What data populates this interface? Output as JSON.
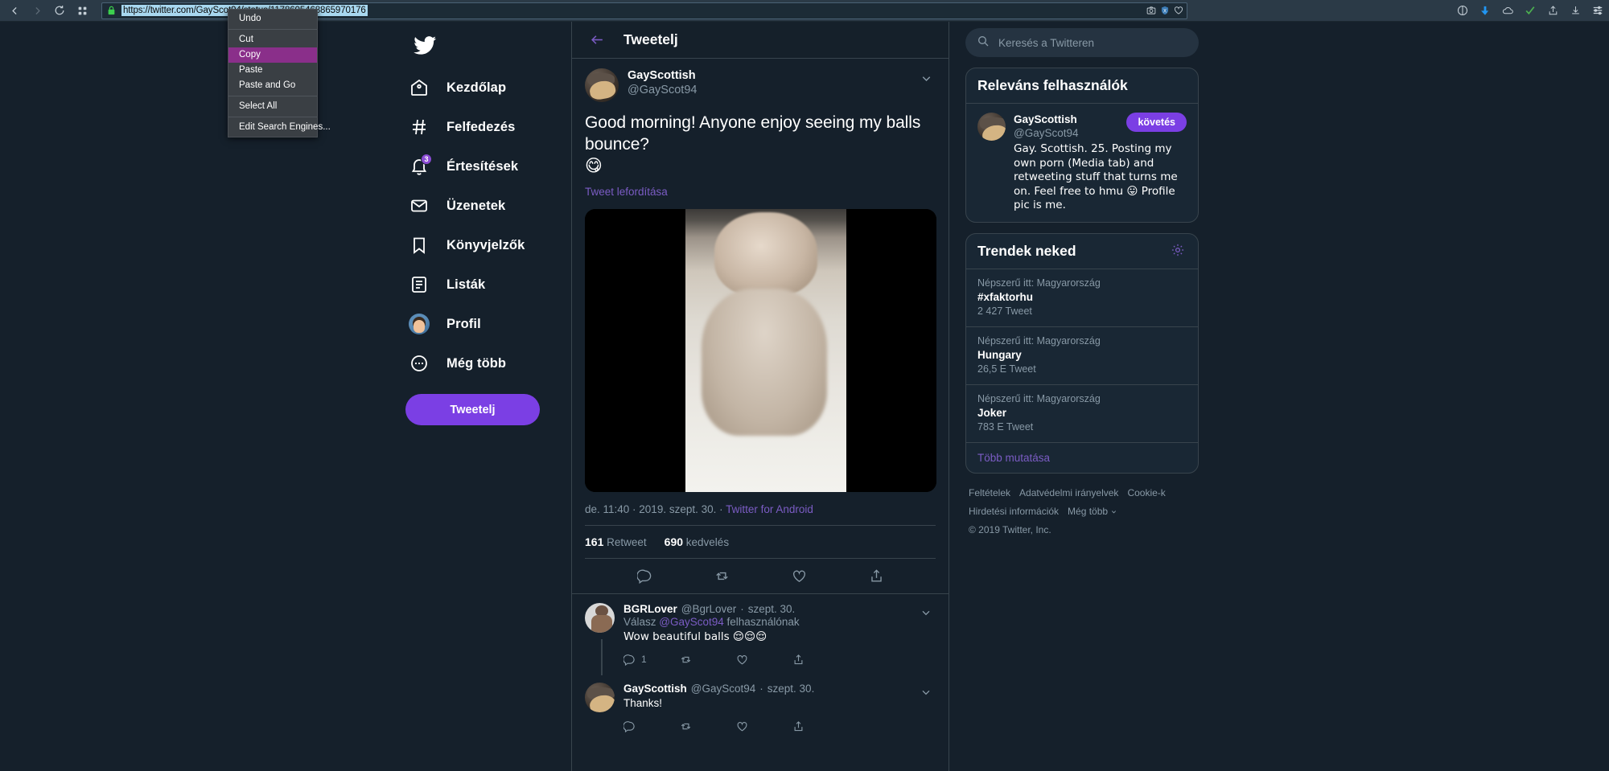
{
  "browser": {
    "url": "https://twitter.com/GayScot94/status/1178605468865970176",
    "nav": {
      "back": "‹",
      "forward": "›"
    },
    "context_menu": {
      "items": [
        {
          "label": "Undo",
          "selected": false,
          "sep_after": true
        },
        {
          "label": "Cut",
          "selected": false,
          "sep_after": false
        },
        {
          "label": "Copy",
          "selected": true,
          "sep_after": false
        },
        {
          "label": "Paste",
          "selected": false,
          "sep_after": false
        },
        {
          "label": "Paste and Go",
          "selected": false,
          "sep_after": true
        },
        {
          "label": "Select All",
          "selected": false,
          "sep_after": true
        },
        {
          "label": "Edit Search Engines...",
          "selected": false,
          "sep_after": false
        }
      ]
    }
  },
  "sidebar": {
    "logo": "twitter-bird",
    "items": [
      {
        "label": "Kezdőlap",
        "icon": "home-icon",
        "badge": ""
      },
      {
        "label": "Felfedezés",
        "icon": "hashtag-icon",
        "badge": ""
      },
      {
        "label": "Értesítések",
        "icon": "bell-icon",
        "badge": "3"
      },
      {
        "label": "Üzenetek",
        "icon": "envelope-icon",
        "badge": ""
      },
      {
        "label": "Könyvjelzők",
        "icon": "bookmark-icon",
        "badge": ""
      },
      {
        "label": "Listák",
        "icon": "list-icon",
        "badge": ""
      },
      {
        "label": "Profil",
        "icon": "avatar-icon",
        "badge": ""
      },
      {
        "label": "Még több",
        "icon": "more-icon",
        "badge": ""
      }
    ],
    "compose_button": "Tweetelj"
  },
  "main": {
    "header_title": "Tweetelj",
    "tweet": {
      "display_name": "GayScottish",
      "handle": "@GayScot94",
      "text": "Good morning! Anyone enjoy seeing my balls bounce?",
      "emoji": "😋",
      "translate_link": "Tweet lefordítása",
      "timestamp": "de. 11:40 · 2019. szept. 30.",
      "separator": " · ",
      "source": "Twitter for Android",
      "retweet_count": "161",
      "retweet_label": "Retweet",
      "like_count": "690",
      "like_label": "kedvelés"
    },
    "replies": [
      {
        "display_name": "BGRLover",
        "handle": "@BgrLover",
        "dot": "·",
        "time": "szept. 30.",
        "replying_prefix": "Válasz ",
        "replying_mention": "@GayScot94",
        "replying_suffix": " felhasználónak",
        "text": "Wow beautiful balls 😌😌😌",
        "reply_count": "1",
        "avatar": "bgrlover-avatar"
      },
      {
        "display_name": "GayScottish",
        "handle": "@GayScot94",
        "dot": "·",
        "time": "szept. 30.",
        "replying_prefix": "",
        "replying_mention": "",
        "replying_suffix": "",
        "text": "Thanks!",
        "reply_count": "",
        "avatar": "gayscottish-avatar"
      }
    ]
  },
  "right": {
    "search_placeholder": "Keresés a Twitteren",
    "relevant_users": {
      "title": "Releváns felhasználók",
      "user": {
        "display_name": "GayScottish",
        "handle": "@GayScot94",
        "follow_label": "követés",
        "bio": "Gay. Scottish. 25. Posting my own porn (Media tab) and retweeting stuff that turns me on. Feel free to hmu 😛 Profile pic is me."
      }
    },
    "trends": {
      "title": "Trendek neked",
      "items": [
        {
          "context": "Népszerű itt: Magyarország",
          "name": "#xfaktorhu",
          "count": "2 427 Tweet"
        },
        {
          "context": "Népszerű itt: Magyarország",
          "name": "Hungary",
          "count": "26,5 E Tweet"
        },
        {
          "context": "Népszerű itt: Magyarország",
          "name": "Joker",
          "count": "783 E Tweet"
        }
      ],
      "show_more": "Több mutatása"
    },
    "footer": {
      "line1": [
        "Feltételek",
        "Adatvédelmi irányelvek",
        "Cookie-k"
      ],
      "line2": [
        "Hirdetési információk",
        "Még több"
      ],
      "copyright": "© 2019 Twitter, Inc."
    }
  },
  "colors": {
    "background": "#15202b",
    "accent": "#7b3fe4",
    "card": "#192734",
    "border": "#38444d",
    "muted": "#8899a6",
    "link": "#7b5cc4",
    "menu_highlight": "#8a2f8a"
  }
}
